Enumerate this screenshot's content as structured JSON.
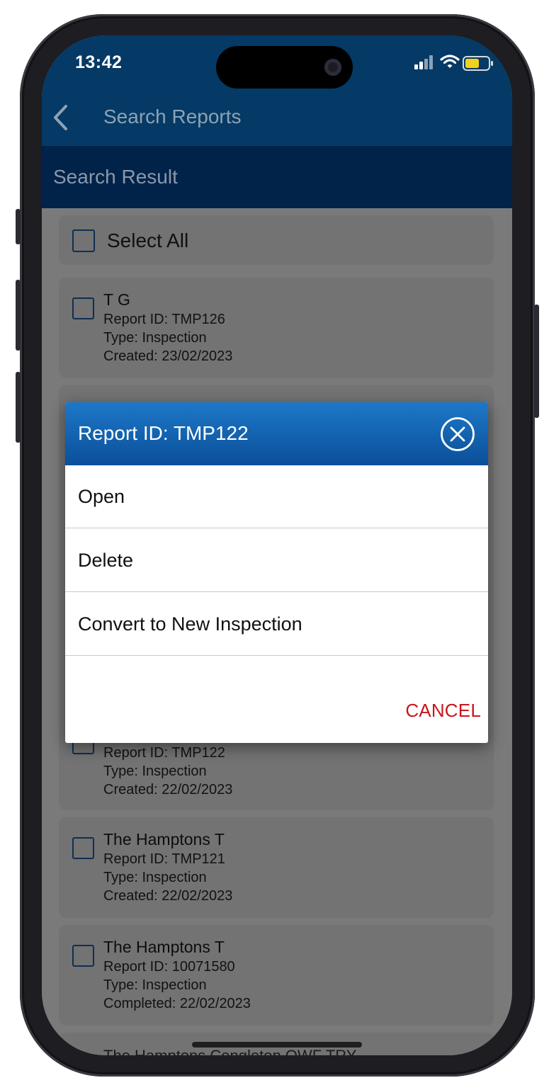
{
  "status_bar": {
    "time": "13:42"
  },
  "header": {
    "title": "Search Reports"
  },
  "sub_header": {
    "title": "Search Result"
  },
  "select_all": {
    "label": "Select All"
  },
  "reports": [
    {
      "title": "T  G",
      "report_id": "Report ID: TMP126",
      "type": "Type: Inspection",
      "date": "Created: 23/02/2023"
    },
    {
      "title": "",
      "report_id": "Report ID: TMP122",
      "type": "Type: Inspection",
      "date": "Created: 22/02/2023"
    },
    {
      "title": "The Hamptons   T",
      "report_id": "Report ID: TMP121",
      "type": "Type: Inspection",
      "date": "Created: 22/02/2023"
    },
    {
      "title": "The Hamptons   T",
      "report_id": "Report ID: 10071580",
      "type": "Type: Inspection",
      "date": "Completed: 22/02/2023"
    },
    {
      "title": "The Hamptons  Congleton OWF TRY"
    }
  ],
  "dialog": {
    "title": "Report ID: TMP122",
    "options": [
      "Open",
      "Delete",
      "Convert to New Inspection"
    ],
    "cancel": "CANCEL"
  },
  "colors": {
    "header_bg": "#043a65",
    "sub_header_bg": "#012249",
    "dialog_header": "#0b5aa8",
    "cancel": "#c8161e"
  }
}
